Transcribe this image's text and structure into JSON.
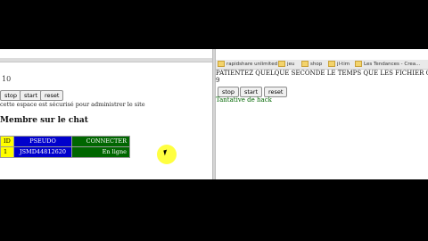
{
  "left": {
    "counter": "10",
    "buttons": {
      "stop": "stop",
      "start": "start",
      "reset": "reset"
    },
    "note": "cette espace est sécurisé pour administrer le site",
    "heading": "Membre sur le chat",
    "table": {
      "headers": {
        "id": "ID",
        "pseudo": "PSEUDO",
        "connect": "CONNECTER"
      },
      "rows": [
        {
          "id": "1",
          "pseudo": "JSMD44812620",
          "status": "En ligne"
        }
      ]
    }
  },
  "right": {
    "bookmarks": [
      "rapidshare unlimited",
      "jeu",
      "shop",
      "jl-tim",
      "Les Tendances - Crea..."
    ],
    "waiting": "PATIENTEZ QUELQUE SECONDE LE TEMPS QUE LES FICHIER CE C",
    "counter": "9",
    "buttons": {
      "stop": "stop",
      "start": "start",
      "reset": "reset"
    },
    "hack_text": "Tantative de hack"
  },
  "colors": {
    "id_bg": "#ffff00",
    "pseudo_bg": "#0000cc",
    "connect_bg": "#006600",
    "cursor_highlight": "#ffff00"
  }
}
